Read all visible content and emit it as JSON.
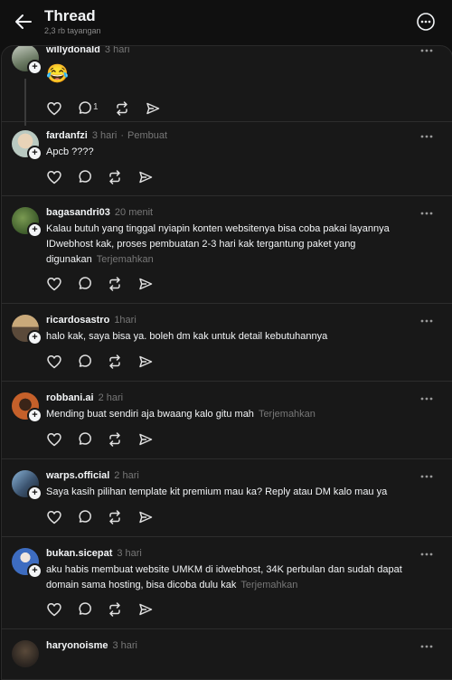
{
  "header": {
    "title": "Thread",
    "views": "2,3 rb tayangan"
  },
  "posts": [
    {
      "username": "willydonald",
      "time": "3 hari",
      "text": "",
      "emoji": "😂",
      "reply_count": "1",
      "translate": "",
      "role": ""
    },
    {
      "username": "fardanfzi",
      "time": "3 hari",
      "role": "Pembuat",
      "text": "Apcb ????",
      "translate": ""
    },
    {
      "username": "bagasandri03",
      "time": "20 menit",
      "text": "Kalau butuh yang tinggal nyiapin konten websitenya bisa coba pakai layannya IDwebhost kak, proses pembuatan 2-3 hari kak tergantung paket yang digunakan",
      "translate": "Terjemahkan"
    },
    {
      "username": "ricardosastro",
      "time": "1hari",
      "text": "halo kak, saya bisa ya. boleh dm kak untuk detail kebutuhannya",
      "translate": ""
    },
    {
      "username": "robbani.ai",
      "time": "2 hari",
      "text": "Mending buat sendiri aja bwaang kalo gitu mah",
      "translate": "Terjemahkan"
    },
    {
      "username": "warps.official",
      "time": "2 hari",
      "text": "Saya kasih pilihan template kit premium mau ka? Reply atau DM kalo mau ya",
      "translate": ""
    },
    {
      "username": "bukan.sicepat",
      "time": "3 hari",
      "text": "aku habis membuat website UMKM di idwebhost, 34K perbulan dan sudah dapat domain sama hosting, bisa dicoba dulu kak",
      "translate": "Terjemahkan"
    },
    {
      "username": "haryonoisme",
      "time": "3 hari",
      "text": "",
      "translate": ""
    }
  ],
  "colors": {
    "background": "#101010",
    "panel": "#181818",
    "text": "#f3f5f7",
    "muted": "#777777"
  }
}
